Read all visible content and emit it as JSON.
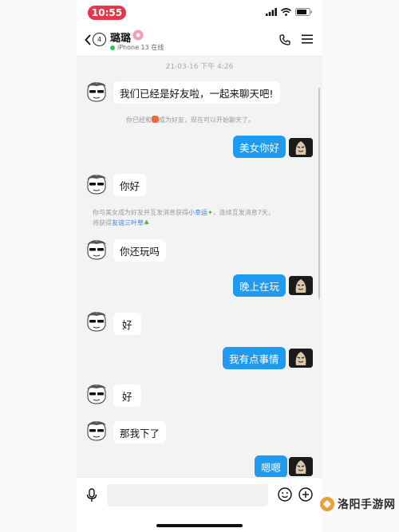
{
  "status_bar": {
    "time": "10:55"
  },
  "header": {
    "unread_count": "4",
    "contact_name": "璐璐",
    "device_status": "iPhone 13 在线"
  },
  "chat": {
    "timestamp": "21-03-16 下午 4:26",
    "messages": [
      {
        "side": "left",
        "text": "我们已经是好友啦，一起来聊天吧!"
      },
      {
        "side": "system",
        "text_before": "你已经和",
        "text_after": "成为好友，现在可以开始聊天了。"
      },
      {
        "side": "right",
        "text": "美女你好"
      },
      {
        "side": "left",
        "text": "你好"
      },
      {
        "side": "system",
        "line1_before": "你与美女成为好友并互发消息获得",
        "line1_link": "小幸运",
        "line1_after": "，连续互发消息7天，",
        "line2_before": "将获得",
        "line2_link": "友谊三叶草"
      },
      {
        "side": "left",
        "text": "你还玩吗"
      },
      {
        "side": "right",
        "text": "晚上在玩"
      },
      {
        "side": "left",
        "text": "好"
      },
      {
        "side": "right",
        "text": "我有点事情"
      },
      {
        "side": "left",
        "text": "好"
      },
      {
        "side": "left",
        "text": "那我下了"
      },
      {
        "side": "right",
        "text": "嗯嗯"
      }
    ]
  },
  "input_bar": {
    "placeholder": ""
  },
  "watermark": {
    "text": "洛阳手游网"
  },
  "colors": {
    "accent_blue": "#1e9bf0",
    "status_red": "#e5374a",
    "online_green": "#2fc45a"
  }
}
